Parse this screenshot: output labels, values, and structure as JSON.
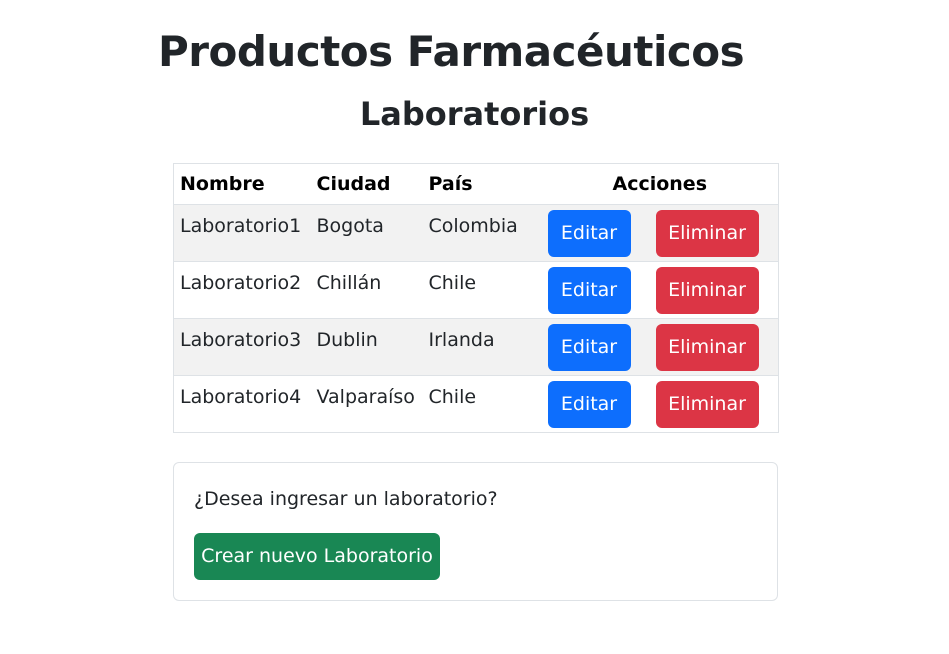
{
  "header": {
    "app_title": "Productos Farmacéuticos",
    "section_title": "Laboratorios"
  },
  "table": {
    "columns": [
      "Nombre",
      "Ciudad",
      "País",
      "Acciones"
    ],
    "rows": [
      {
        "nombre": "Laboratorio1",
        "ciudad": "Bogota",
        "pais": "Colombia"
      },
      {
        "nombre": "Laboratorio2",
        "ciudad": "Chillán",
        "pais": "Chile"
      },
      {
        "nombre": "Laboratorio3",
        "ciudad": "Dublin",
        "pais": "Irlanda"
      },
      {
        "nombre": "Laboratorio4",
        "ciudad": "Valparaíso",
        "pais": "Chile"
      }
    ],
    "edit_label": "Editar",
    "delete_label": "Eliminar"
  },
  "card": {
    "prompt": "¿Desea ingresar un laboratorio?",
    "create_label": "Crear nuevo Laboratorio"
  },
  "colors": {
    "edit": "#0d6efd",
    "delete": "#dc3545",
    "create": "#198754",
    "stripe": "#f2f2f2"
  }
}
